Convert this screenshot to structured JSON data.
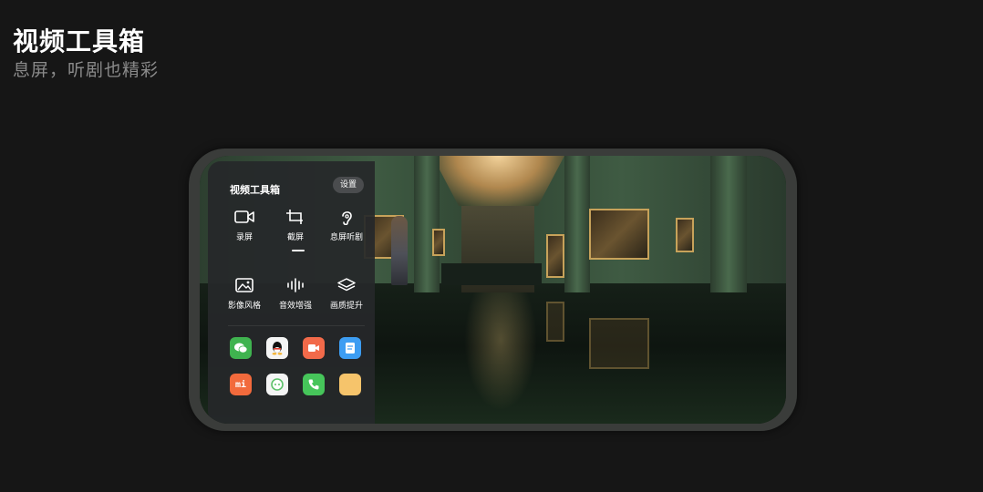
{
  "header": {
    "title": "视频工具箱",
    "subtitle": "息屏，听剧也精彩"
  },
  "panel": {
    "title": "视频工具箱",
    "settings_label": "设置",
    "tools": [
      {
        "label": "录屏",
        "icon": "video-camera-icon"
      },
      {
        "label": "截屏",
        "icon": "crop-icon"
      },
      {
        "label": "息屏听剧",
        "icon": "ear-icon"
      },
      {
        "label": "影像风格",
        "icon": "image-style-icon"
      },
      {
        "label": "音效增强",
        "icon": "sound-wave-icon"
      },
      {
        "label": "画质提升",
        "icon": "layers-icon"
      }
    ],
    "apps": [
      {
        "icon": "wechat-icon",
        "color": "#3fb34f"
      },
      {
        "icon": "qq-icon",
        "color": "#f4f4f4"
      },
      {
        "icon": "screen-recorder-app-icon",
        "color": "#f26a4a"
      },
      {
        "icon": "notes-app-icon",
        "color": "#3d9df2"
      },
      {
        "icon": "mi-icon",
        "color": "#f26a3c",
        "text": "mi"
      },
      {
        "icon": "mi-chat-icon",
        "color": "#f4f4f4"
      },
      {
        "icon": "phone-app-icon",
        "color": "#46c55a"
      },
      {
        "icon": "yellow-app-icon",
        "color": "#f6c46b"
      }
    ]
  }
}
